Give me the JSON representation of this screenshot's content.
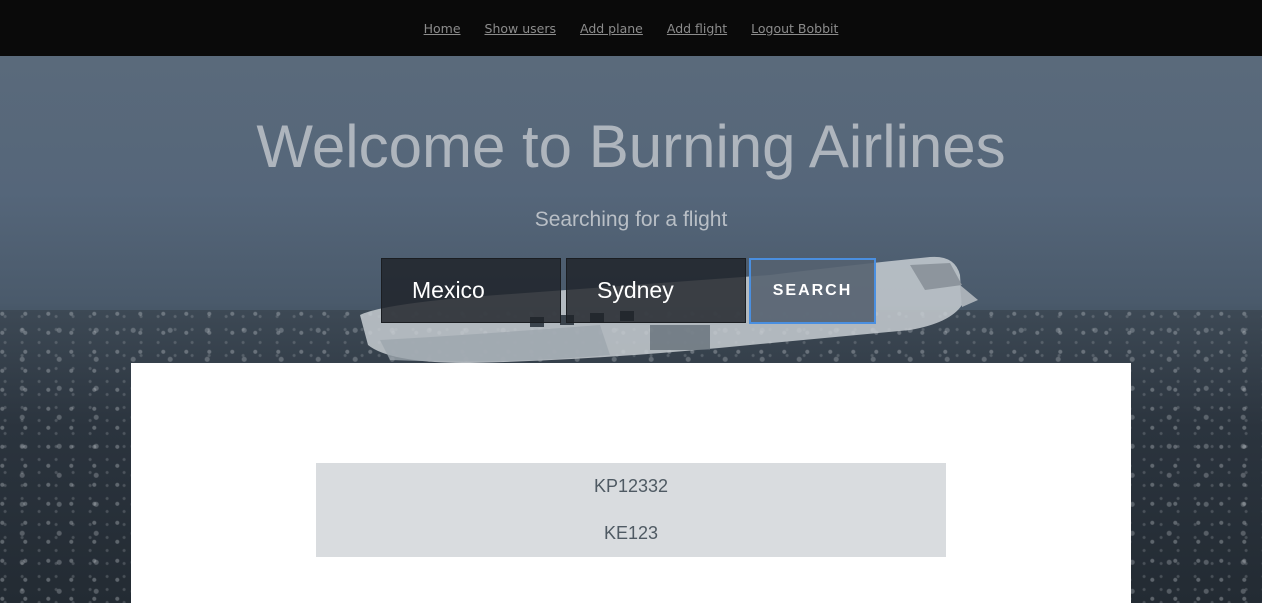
{
  "nav": {
    "links": [
      "Home",
      "Show users",
      "Add plane",
      "Add flight",
      "Logout Bobbit"
    ]
  },
  "hero": {
    "title": "Welcome to Burning Airlines",
    "subtitle": "Searching for a flight"
  },
  "search": {
    "origin_value": "Mexico",
    "destination_value": "Sydney",
    "button_label": "SEARCH"
  },
  "results": {
    "flights": [
      "KP12332",
      "KE123"
    ]
  },
  "colors": {
    "navbar": "#0a0a0a",
    "accent_border": "#4a8fe0",
    "results_bg": "#d9dcdf"
  }
}
